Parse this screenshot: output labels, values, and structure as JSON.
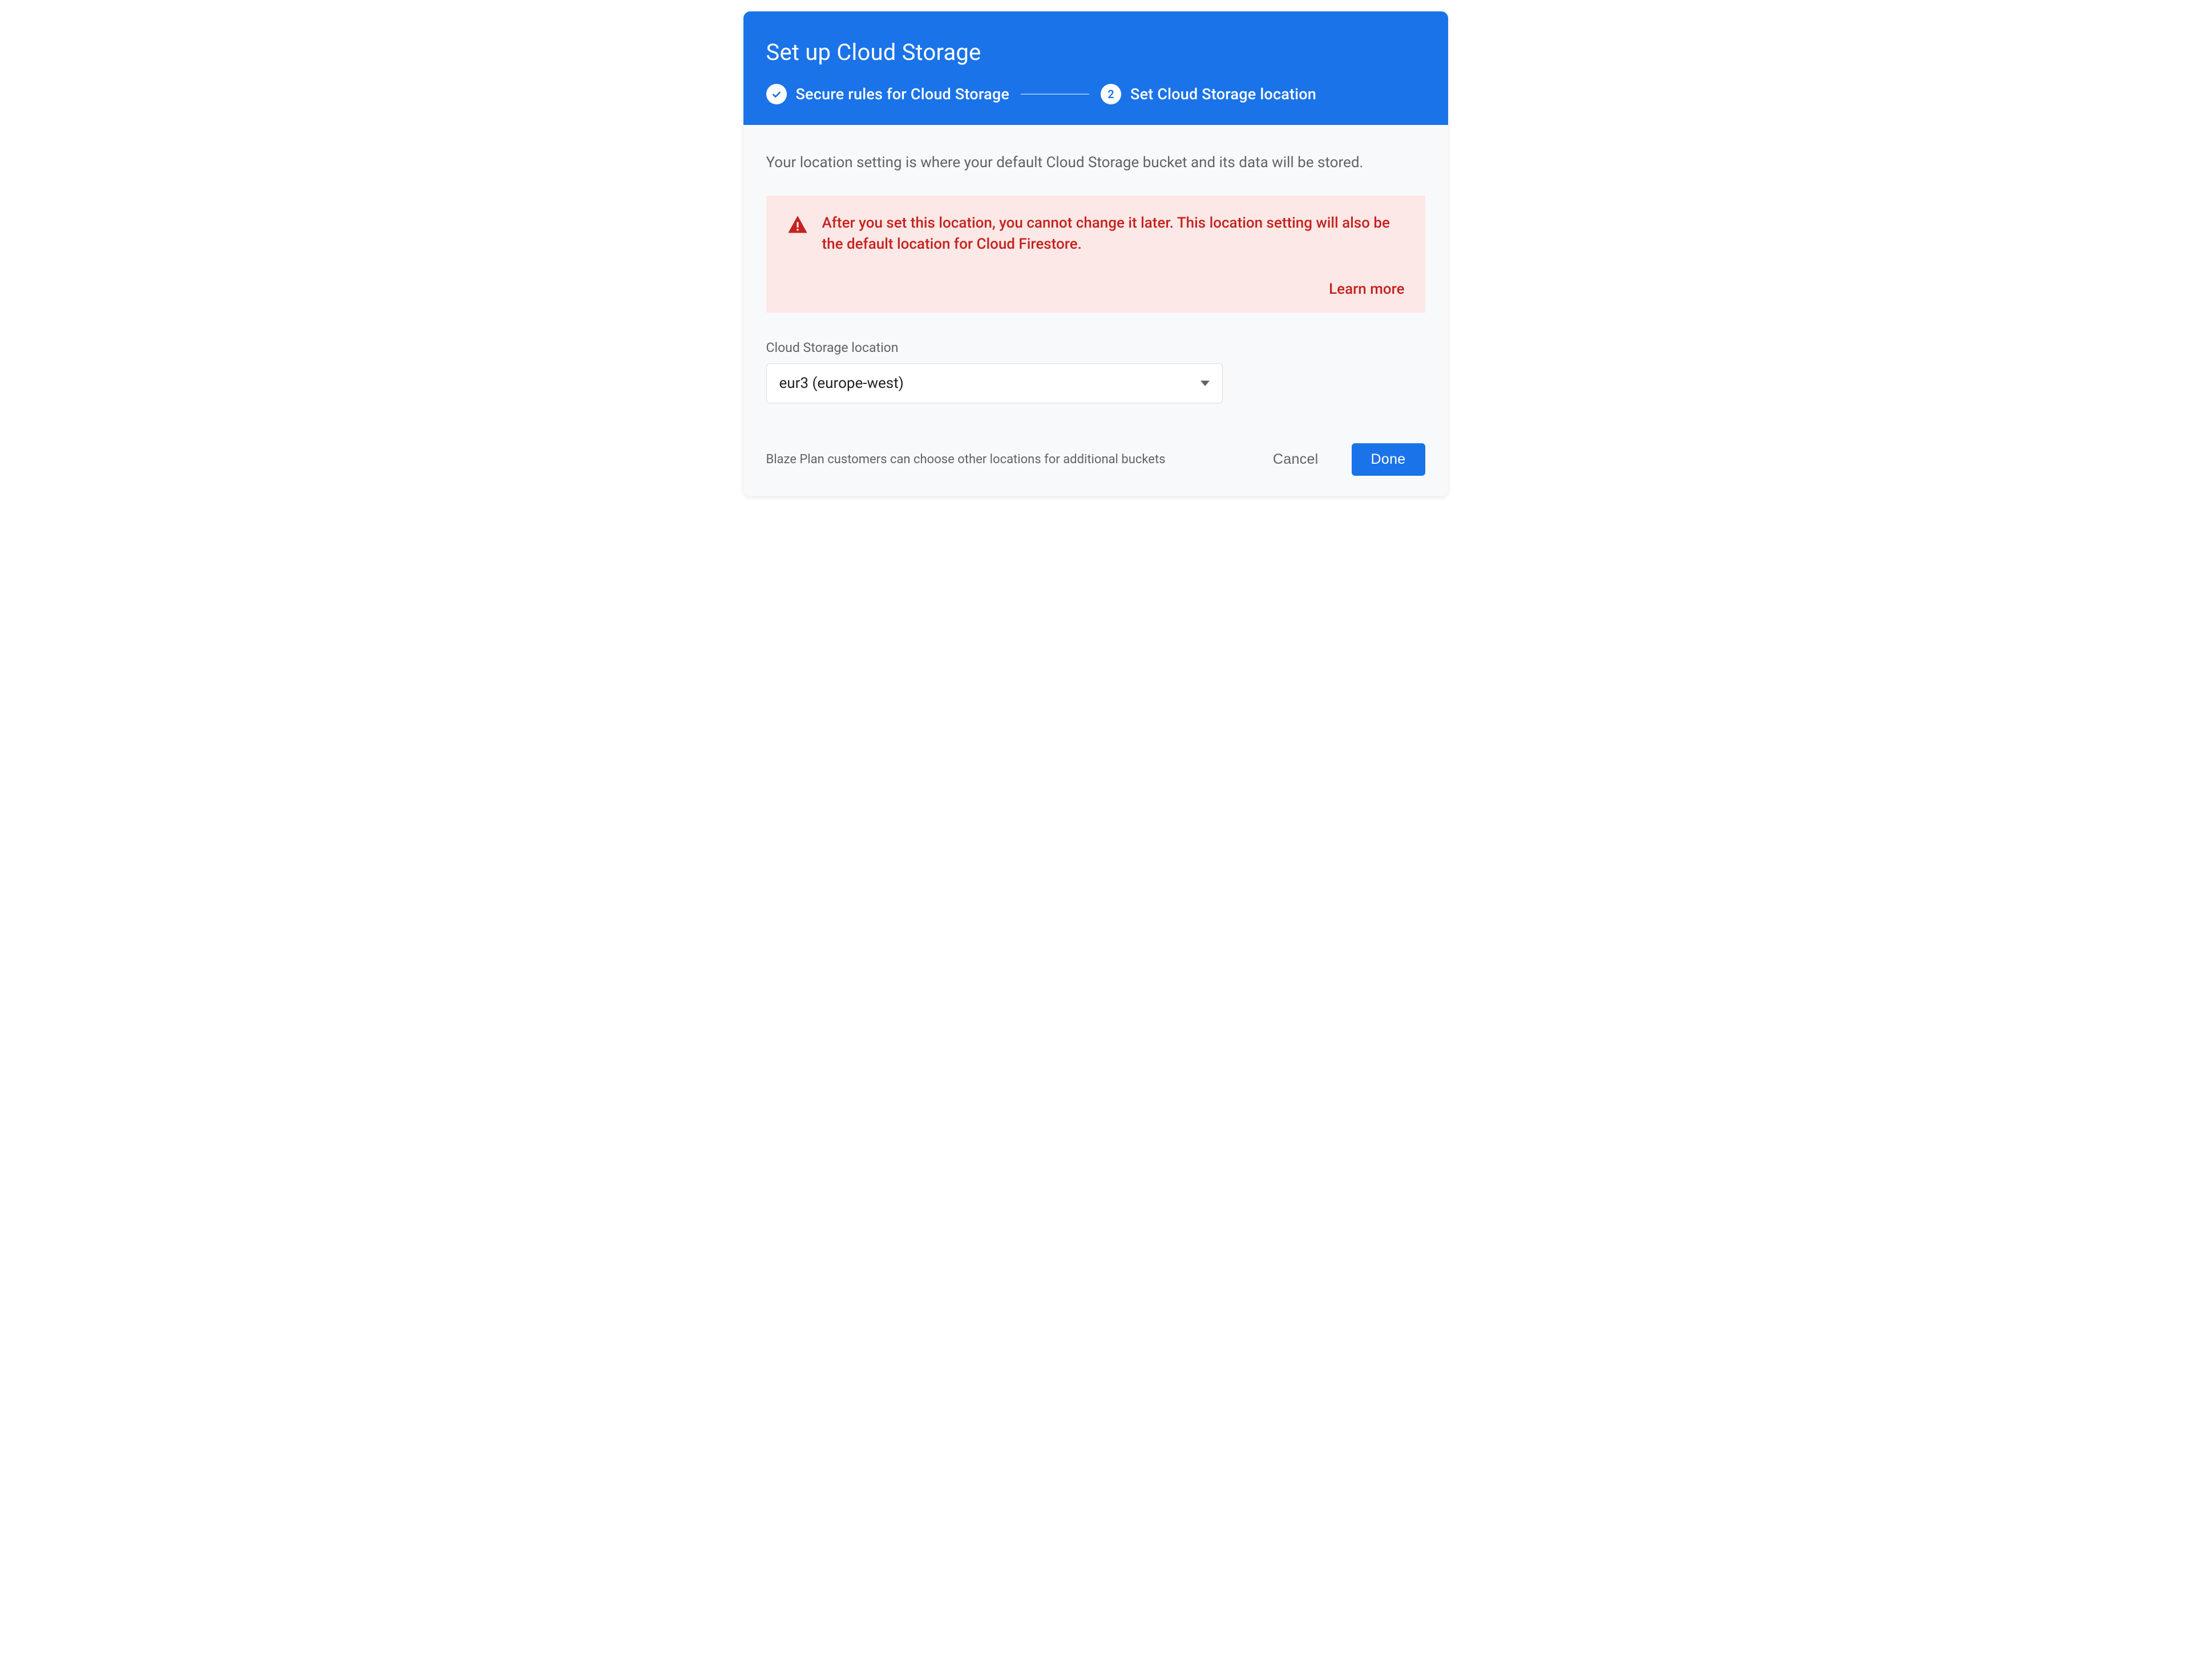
{
  "header": {
    "title": "Set up Cloud Storage",
    "steps": [
      {
        "label": "Secure rules for Cloud Storage",
        "state": "done"
      },
      {
        "number": "2",
        "label": "Set Cloud Storage location",
        "state": "active"
      }
    ]
  },
  "body": {
    "description": "Your location setting is where your default Cloud Storage bucket and its data will be stored.",
    "warning": {
      "text": "After you set this location, you cannot change it later. This location setting will also be the default location for Cloud Firestore.",
      "learn_more": "Learn more"
    },
    "location_field": {
      "label": "Cloud Storage location",
      "value": "eur3 (europe-west)"
    },
    "footer_note": "Blaze Plan customers can choose other locations for additional buckets"
  },
  "actions": {
    "cancel": "Cancel",
    "done": "Done"
  },
  "colors": {
    "primary": "#1a73e8",
    "danger": "#c5221f",
    "danger_bg": "#fce8e6",
    "text_muted": "#5f6368"
  }
}
